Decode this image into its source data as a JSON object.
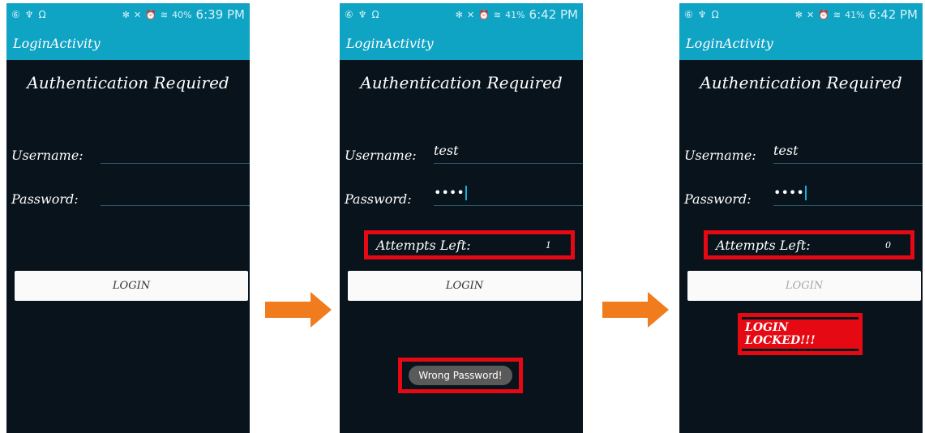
{
  "screens": [
    {
      "status_time": "6:39 PM",
      "battery": "40%",
      "app_title": "LoginActivity",
      "heading": "Authentication Required",
      "username_label": "Username:",
      "username_value": "",
      "password_label": "Password:",
      "password_value": "",
      "login_label": "LOGIN"
    },
    {
      "status_time": "6:42 PM",
      "battery": "41%",
      "app_title": "LoginActivity",
      "heading": "Authentication Required",
      "username_label": "Username:",
      "username_value": "test",
      "password_label": "Password:",
      "password_value": "••••",
      "attempts_label": "Attempts Left:",
      "attempts_value": "1",
      "login_label": "LOGIN",
      "toast": "Wrong Password!"
    },
    {
      "status_time": "6:42 PM",
      "battery": "41%",
      "app_title": "LoginActivity",
      "heading": "Authentication Required",
      "username_label": "Username:",
      "username_value": "test",
      "password_label": "Password:",
      "password_value": "••••",
      "attempts_label": "Attempts Left:",
      "attempts_value": "0",
      "login_label": "LOGIN",
      "locked_text": "LOGIN LOCKED!!!"
    }
  ],
  "colors": {
    "action_bar": "#0fa3c4",
    "screen_bg": "#08131b",
    "highlight": "#e50914",
    "arrow": "#f07c1e"
  },
  "icons": [
    "status-icon-set",
    "arrow-right-icon"
  ]
}
